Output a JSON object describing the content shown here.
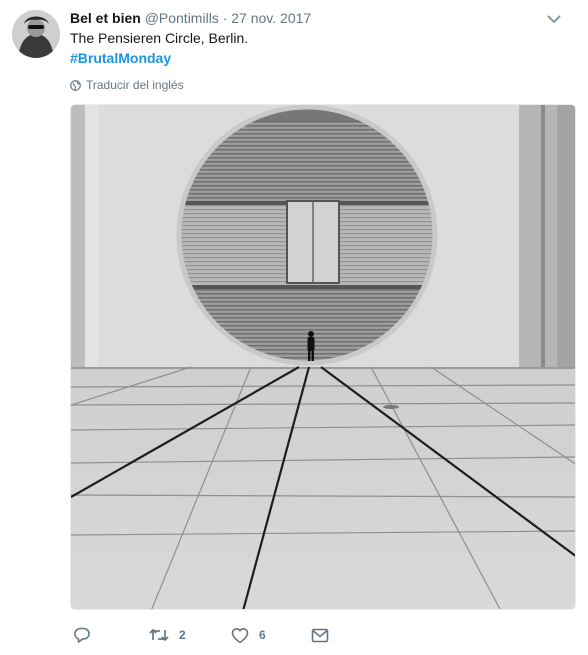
{
  "tweet": {
    "name": "Bel et bien",
    "handle": "@Pontimills",
    "separator": "·",
    "date": "27 nov. 2017",
    "text_line": "The Pensieren Circle, Berlin.",
    "hashtag": "#BrutalMonday",
    "translate_label": "Traducir del inglés"
  },
  "actions": {
    "retweet_count": "2",
    "like_count": "6"
  },
  "icons": {
    "avatar": "avatar",
    "caret": "chevron-down-icon",
    "globe": "globe-icon",
    "reply": "reply-icon",
    "retweet": "retweet-icon",
    "like": "heart-icon",
    "message": "envelope-icon"
  },
  "colors": {
    "link": "#1b95e0",
    "secondary": "#657786",
    "text": "#14171a"
  }
}
